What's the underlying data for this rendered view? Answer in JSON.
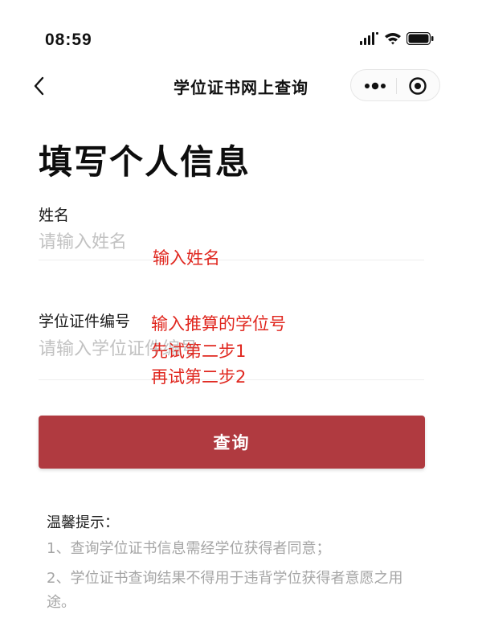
{
  "status_bar": {
    "time": "08:59"
  },
  "nav": {
    "title": "学位证书网上查询"
  },
  "form": {
    "title": "填写个人信息",
    "name_label": "姓名",
    "name_placeholder": "请输入姓名",
    "name_value": "",
    "cert_label": "学位证件编号",
    "cert_placeholder": "请输入学位证件编号",
    "cert_value": ""
  },
  "annotations": {
    "name_hint": "输入姓名",
    "cert_hint_1": "输入推算的学位号",
    "cert_hint_2": "先试第二步1",
    "cert_hint_3": "再试第二步2"
  },
  "actions": {
    "query_label": "查询"
  },
  "tips": {
    "title": "温馨提示：",
    "items": [
      "1、查询学位证书信息需经学位获得者同意；",
      "2、学位证书查询结果不得用于违背学位获得者意愿之用途。"
    ]
  },
  "colors": {
    "primary": "#b03a40",
    "annotation": "#e0271f",
    "placeholder": "#c2c2c2",
    "tip_text": "#a5a5a5"
  }
}
